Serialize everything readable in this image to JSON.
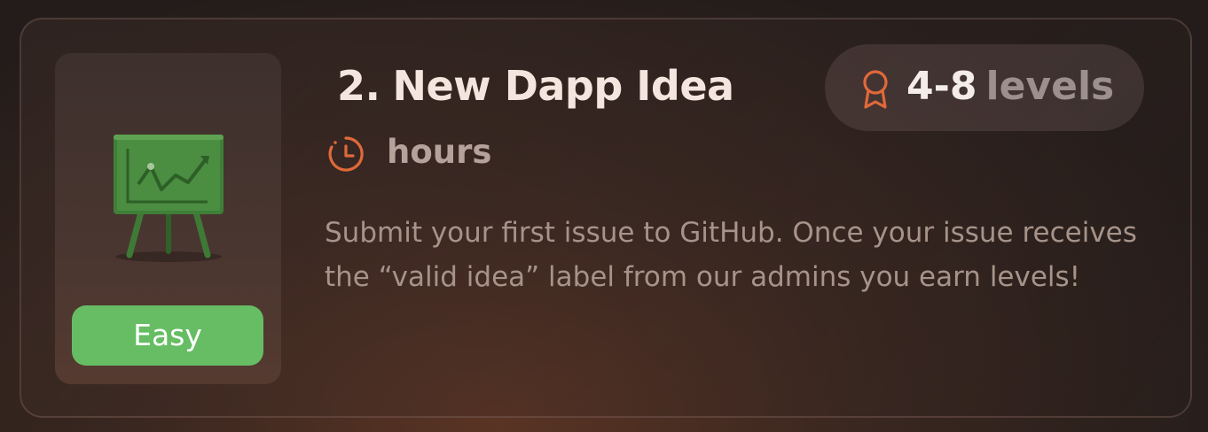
{
  "card": {
    "index": "2.",
    "title": "New Dapp Idea",
    "duration": "hours",
    "description": "Submit your first issue to GitHub. Once your issue receives the “valid idea” label from our admins you earn levels!",
    "difficulty": "Easy",
    "reward": {
      "range": "4-8",
      "unit": "levels"
    }
  },
  "icons": {
    "illustration": "presentation-easel-icon",
    "clock": "clock-icon",
    "reward": "award-ribbon-icon"
  },
  "colors": {
    "accent": "#e0693a",
    "difficulty_bg": "#66bd63",
    "title": "#f4e6de",
    "muted": "#a69389"
  }
}
